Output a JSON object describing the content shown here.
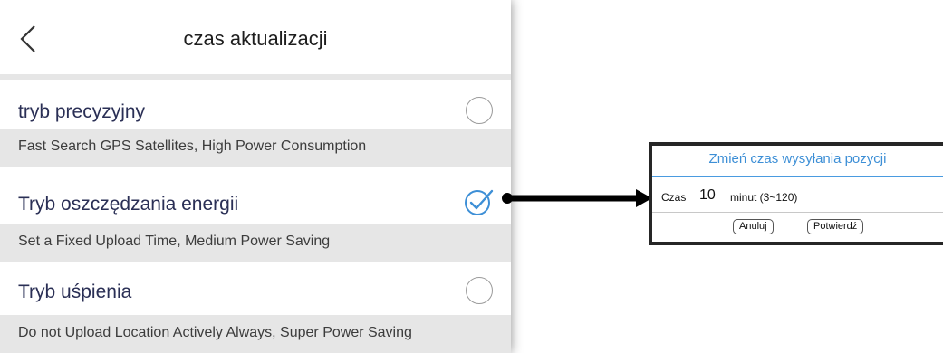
{
  "header": {
    "title": "czas aktualizacji",
    "back_icon": "chevron-left-icon"
  },
  "modes": [
    {
      "label": "tryb precyzyjny",
      "description": "Fast Search GPS Satellites, High Power Consumption",
      "selected": false
    },
    {
      "label": "Tryb oszczędzania energii",
      "description": "Set a Fixed Upload Time, Medium Power Saving",
      "selected": true
    },
    {
      "label": "Tryb uśpienia",
      "description": "Do not Upload Location Actively Always, Super Power Saving",
      "selected": false
    }
  ],
  "dialog": {
    "title": "Zmień czas wysyłania pozycji",
    "time_label": "Czas",
    "time_value": "10",
    "time_unit": "minut (3~120)",
    "cancel_label": "Anuluj",
    "confirm_label": "Potwierdź"
  },
  "colors": {
    "accent": "#3d8fd6",
    "mode_text": "#2a2f55",
    "desc_bg": "#e6e6e6"
  }
}
